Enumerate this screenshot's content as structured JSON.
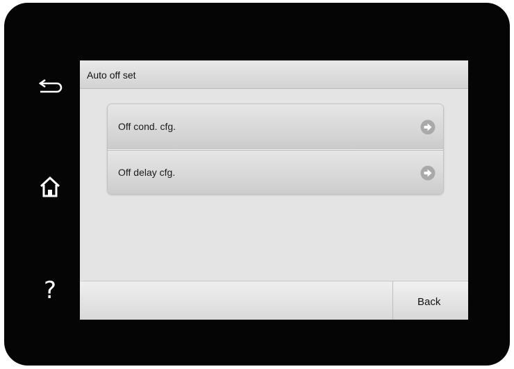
{
  "header": {
    "title": "Auto off set"
  },
  "sidebar": {
    "back_icon": "return-arrow-icon",
    "home_icon": "home-icon",
    "help_icon": "question-mark-icon",
    "help_glyph": "?"
  },
  "menu": {
    "items": [
      {
        "label": "Off cond. cfg.",
        "icon": "arrow-right-circle-icon"
      },
      {
        "label": "Off delay cfg.",
        "icon": "arrow-right-circle-icon"
      }
    ]
  },
  "footer": {
    "back_label": "Back"
  },
  "colors": {
    "bezel": "#050505",
    "screen_bg": "#e4e4e4",
    "arrow_circle": "#a9a9a9"
  }
}
